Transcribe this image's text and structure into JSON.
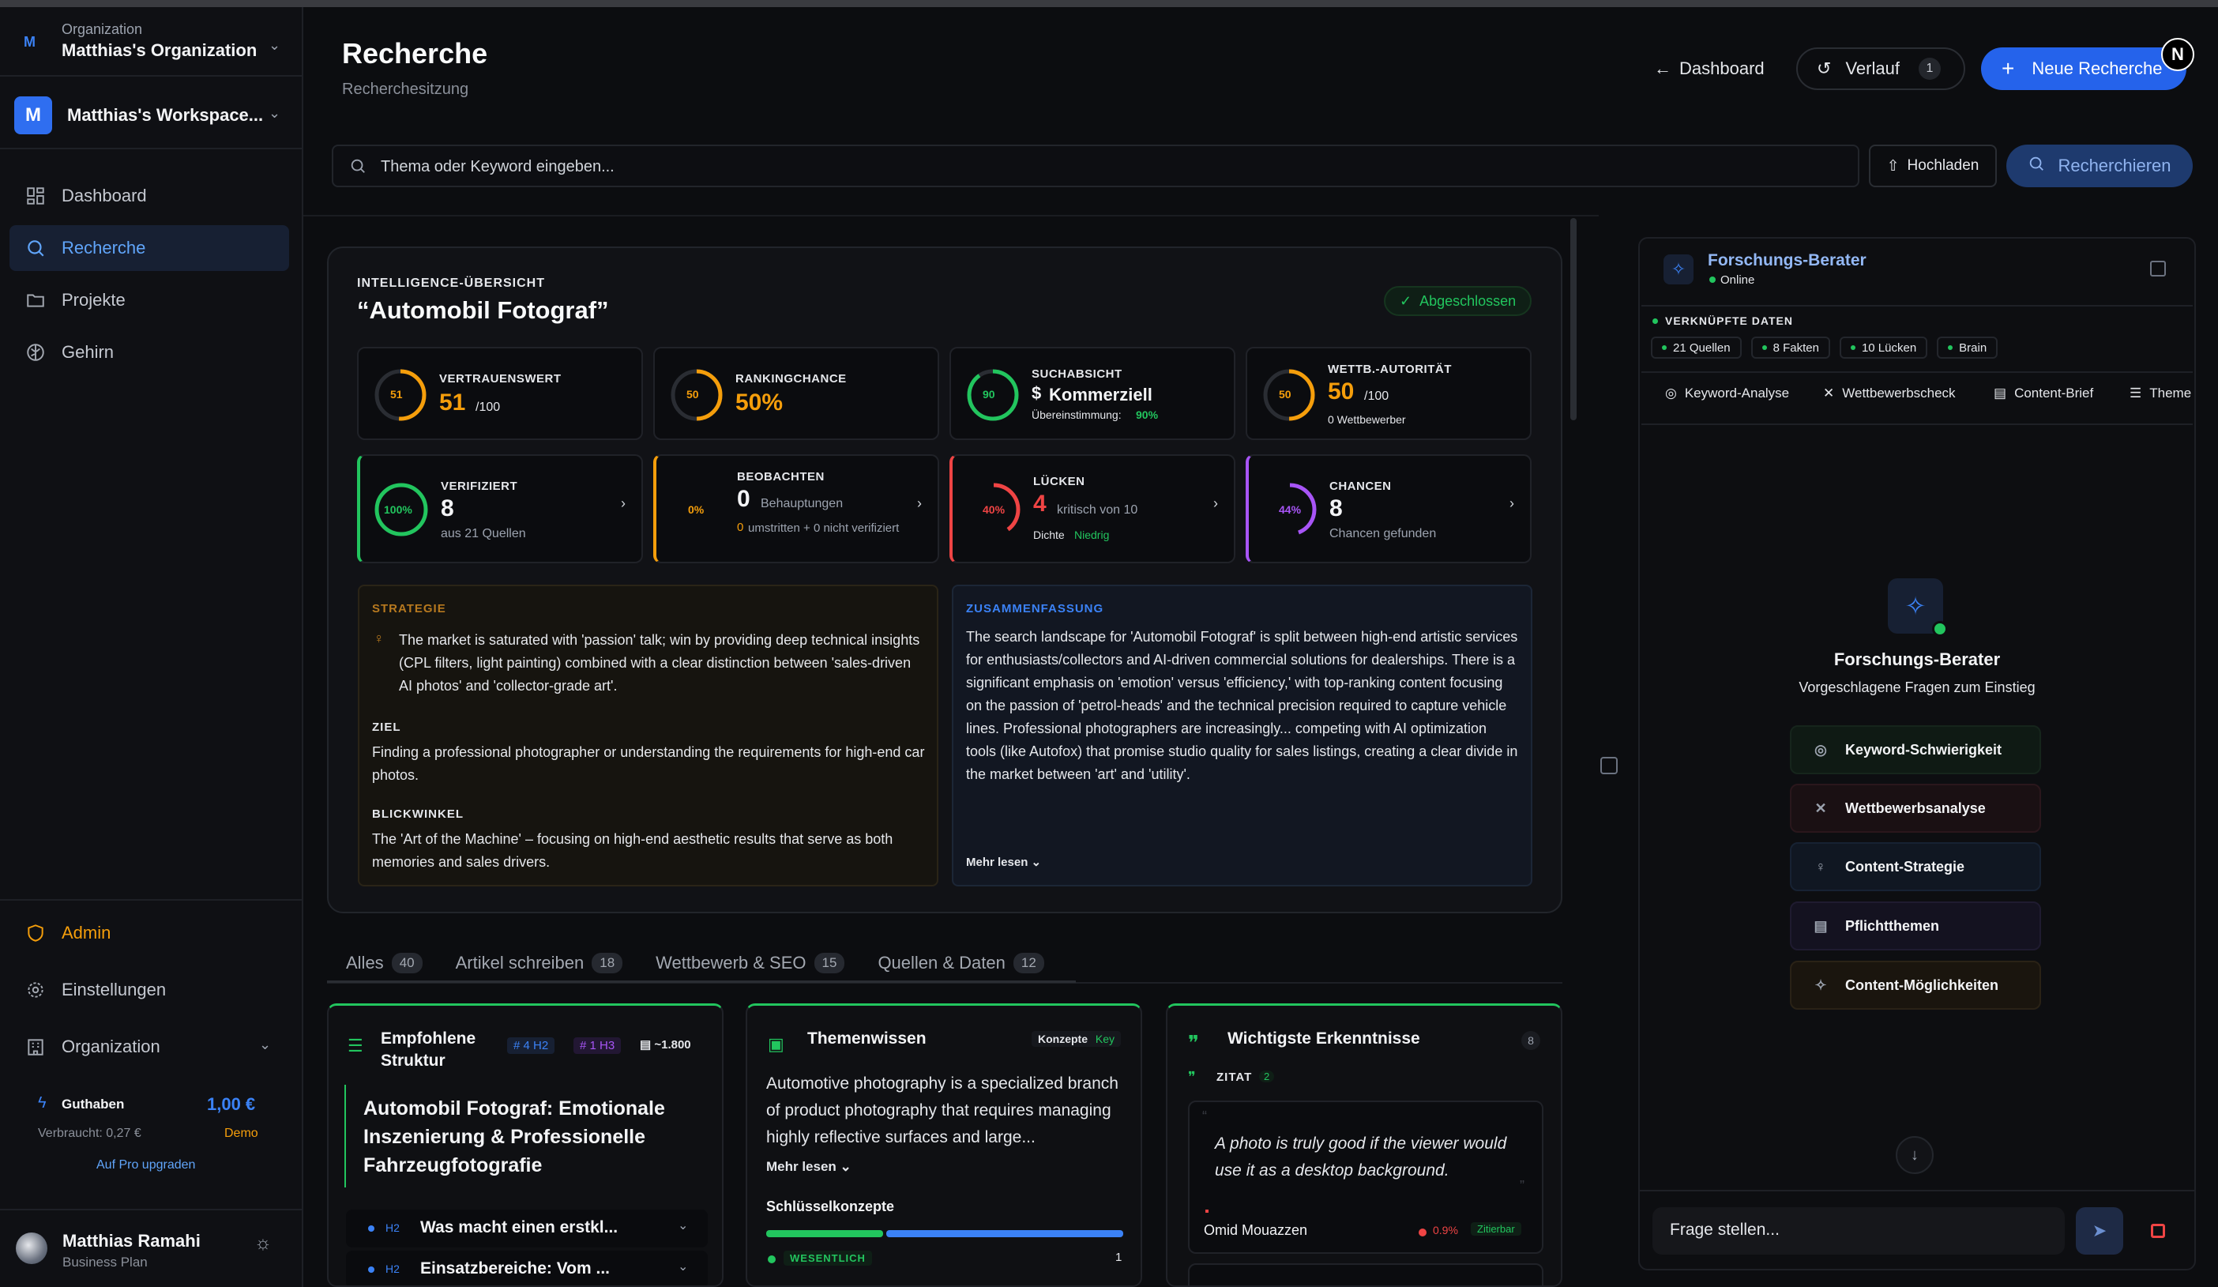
{
  "sidebar": {
    "org_initial": "M",
    "org_label": "Organization",
    "org_name": "Matthias's Organization",
    "ws_initial": "M",
    "ws_name": "Matthias's Workspace...",
    "nav": [
      "Dashboard",
      "Recherche",
      "Projekte",
      "Gehirn"
    ],
    "admin": "Admin",
    "settings": "Einstellungen",
    "organization": "Organization",
    "credits_label": "Guthaben",
    "credits_value": "1,00 €",
    "used": "Verbraucht: 0,27 €",
    "demo": "Demo",
    "upgrade": "Auf Pro upgraden",
    "user_name": "Matthias Ramahi",
    "user_plan": "Business Plan"
  },
  "header": {
    "title": "Recherche",
    "subtitle": "Recherchesitzung",
    "dashboard_btn": "Dashboard",
    "history_btn": "Verlauf",
    "history_count": "1",
    "new_btn": "Neue Recherche",
    "avatar": "N",
    "search_placeholder": "Thema oder Keyword eingeben...",
    "upload_btn": "Hochladen",
    "research_btn": "Recherchieren"
  },
  "intel": {
    "label": "INTELLIGENCE-ÜBERSICHT",
    "title": "“Automobil Fotograf”",
    "status": "Abgeschlossen",
    "m1": {
      "ring": "51",
      "title": "VERTRAUENSWERT",
      "value": "51",
      "unit": "/100"
    },
    "m2": {
      "ring": "50",
      "title": "RANKINGCHANCE",
      "value": "50%"
    },
    "m3": {
      "ring": "90",
      "title": "SUCHABSICHT",
      "value": "Kommerziell",
      "sub": "Übereinstimmung:",
      "sub_val": "90%"
    },
    "m4": {
      "ring": "50",
      "title": "WETTB.-AUTORITÄT",
      "value": "50",
      "unit": "/100",
      "sub": "0 Wettbewerber"
    },
    "m5": {
      "ring": "100%",
      "title": "VERIFIZIERT",
      "value": "8",
      "sub": "aus 21 Quellen"
    },
    "m6": {
      "ring": "0%",
      "title": "BEOBACHTEN",
      "value": "0",
      "unit": "Behauptungen",
      "sub_a": "0",
      "sub_b": "umstritten + 0 nicht verifiziert"
    },
    "m7": {
      "ring": "40%",
      "title": "LÜCKEN",
      "value": "4",
      "unit": "kritisch von 10",
      "sub": "Dichte",
      "sub_val": "Niedrig"
    },
    "m8": {
      "ring": "44%",
      "title": "CHANCEN",
      "value": "8",
      "sub": "Chancen gefunden"
    },
    "strategy_label": "STRATEGIE",
    "strategy_text": "The market is saturated with 'passion' talk; win by providing deep technical insights (CPL filters, light painting) combined with a clear distinction between 'sales-driven AI photos' and 'collector-grade art'.",
    "goal_label": "ZIEL",
    "goal_text": "Finding a professional photographer or understanding the requirements for high-end car photos.",
    "angle_label": "BLICKWINKEL",
    "angle_text": "The 'Art of the Machine' – focusing on high-end aesthetic results that serve as both memories and sales drivers.",
    "summary_label": "ZUSAMMENFASSUNG",
    "summary_text": "The search landscape for 'Automobil Fotograf' is split between high-end artistic services for enthusiasts/collectors and AI-driven commercial solutions for dealerships. There is a significant emphasis on 'emotion' versus 'efficiency,' with top-ranking content focusing on the passion of 'petrol-heads' and the technical precision required to capture vehicle lines. Professional photographers are increasingly... competing with AI optimization tools (like Autofox) that promise studio quality for sales listings, creating a clear divide in the market between 'art' and 'utility'.",
    "more": "Mehr lesen"
  },
  "tabs": [
    {
      "label": "Alles",
      "count": "40"
    },
    {
      "label": "Artikel schreiben",
      "count": "18"
    },
    {
      "label": "Wettbewerb & SEO",
      "count": "15"
    },
    {
      "label": "Quellen & Daten",
      "count": "12"
    }
  ],
  "cards": {
    "structure": {
      "title": "Empfohlene Struktur",
      "h2": "# 4 H2",
      "h3": "# 1 H3",
      "words": "~1.800",
      "headline": "Automobil Fotograf: Emotionale Inszenierung & Professionelle Fahrzeugfotografie",
      "item1_tag": "H2",
      "item1": "Was macht einen erstkl...",
      "item2_tag": "H2",
      "item2": "Einsatzbereiche: Vom ..."
    },
    "knowledge": {
      "title": "Themenwissen",
      "badge": "Konzepte",
      "badge2": "Key",
      "text": "Automotive photography is a specialized branch of product photography that requires managing highly reflective surfaces and large...",
      "more": "Mehr lesen",
      "concepts": "Schlüsselkonzepte",
      "essential": "WESENTLICH",
      "essential_count": "1"
    },
    "insights": {
      "title": "Wichtigste Erkenntnisse",
      "count": "8",
      "quote_label": "ZITAT",
      "quote_count": "2",
      "quote": "A photo is truly good if the viewer would use it as a desktop background.",
      "author": "Omid Mouazzen",
      "pct": "0.9%",
      "cite": "Zitierbar"
    }
  },
  "advisor": {
    "title": "Forschungs-Berater",
    "status": "Online",
    "linked_label": "VERKNÜPFTE DATEN",
    "chips": [
      "21 Quellen",
      "8 Fakten",
      "10 Lücken",
      "Brain"
    ],
    "tabs": [
      "Keyword-Analyse",
      "Wettbewerbscheck",
      "Content-Brief",
      "Theme"
    ],
    "center_title": "Forschungs-Berater",
    "center_sub": "Vorgeschlagene Fragen zum Einstieg",
    "suggestions": [
      "Keyword-Schwierigkeit",
      "Wettbewerbsanalyse",
      "Content-Strategie",
      "Pflichtthemen",
      "Content-Möglichkeiten"
    ],
    "input_placeholder": "Frage stellen..."
  }
}
